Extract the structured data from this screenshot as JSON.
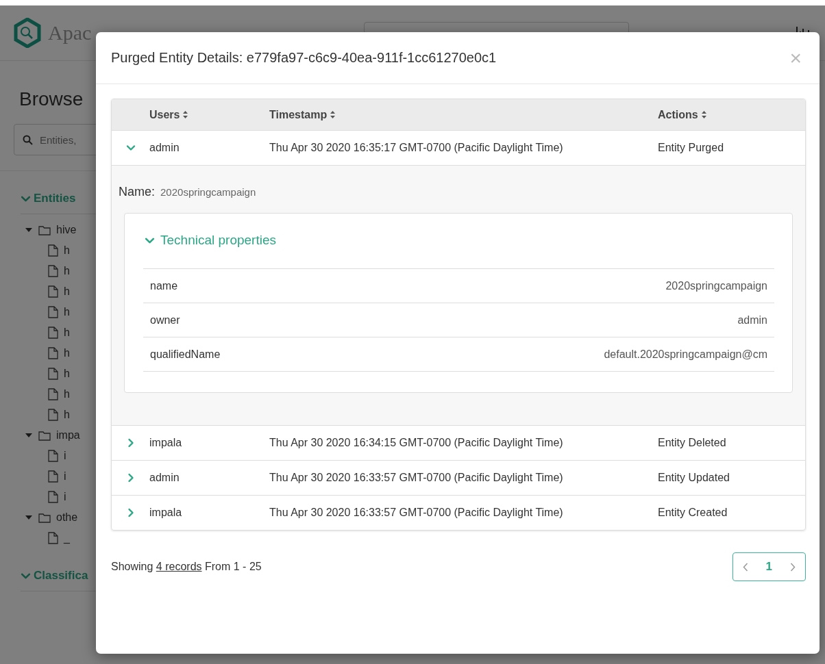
{
  "app": {
    "logo_text": "Apac",
    "page_title": "Browse",
    "search": {
      "placeholder": "Entities,"
    },
    "sections": [
      {
        "title": "Entities",
        "expanded": true,
        "tree": [
          {
            "label": "hive",
            "expanded": true,
            "children": [
              {
                "label": "h"
              },
              {
                "label": "h"
              },
              {
                "label": "h"
              },
              {
                "label": "h"
              },
              {
                "label": "h"
              },
              {
                "label": "h"
              },
              {
                "label": "h"
              },
              {
                "label": "h"
              },
              {
                "label": "h"
              }
            ]
          },
          {
            "label": "impa",
            "expanded": true,
            "children": [
              {
                "label": "i"
              },
              {
                "label": "i"
              },
              {
                "label": "i"
              }
            ]
          },
          {
            "label": "othe",
            "expanded": true,
            "children": [
              {
                "label": "_"
              }
            ]
          }
        ]
      },
      {
        "title": "Classifica",
        "expanded": true
      }
    ]
  },
  "modal": {
    "title": "Purged Entity Details: e779fa97-c6c9-40ea-911f-1cc61270e0c1",
    "close": "×",
    "table": {
      "columns": [
        "Users",
        "Timestamp",
        "Actions"
      ],
      "rows": [
        {
          "user": "admin",
          "timestamp": "Thu Apr 30 2020 16:35:17 GMT-0700 (Pacific Daylight Time)",
          "action": "Entity Purged",
          "expanded": true,
          "detail": {
            "name_label": "Name:",
            "name_value": "2020springcampaign",
            "section": {
              "title": "Technical properties",
              "expanded": true,
              "properties": [
                {
                  "key": "name",
                  "value": "2020springcampaign"
                },
                {
                  "key": "owner",
                  "value": "admin"
                },
                {
                  "key": "qualifiedName",
                  "value": "default.2020springcampaign@cm"
                }
              ]
            }
          }
        },
        {
          "user": "impala",
          "timestamp": "Thu Apr 30 2020 16:34:15 GMT-0700 (Pacific Daylight Time)",
          "action": "Entity Deleted",
          "expanded": false
        },
        {
          "user": "admin",
          "timestamp": "Thu Apr 30 2020 16:33:57 GMT-0700 (Pacific Daylight Time)",
          "action": "Entity Updated",
          "expanded": false
        },
        {
          "user": "impala",
          "timestamp": "Thu Apr 30 2020 16:33:57 GMT-0700 (Pacific Daylight Time)",
          "action": "Entity Created",
          "expanded": false
        }
      ]
    },
    "footer": {
      "prefix": "Showing",
      "link": "4 records",
      "suffix": "From 1 - 25"
    },
    "pagination": {
      "pages": [
        {
          "label": "1",
          "selected": true
        }
      ]
    }
  }
}
